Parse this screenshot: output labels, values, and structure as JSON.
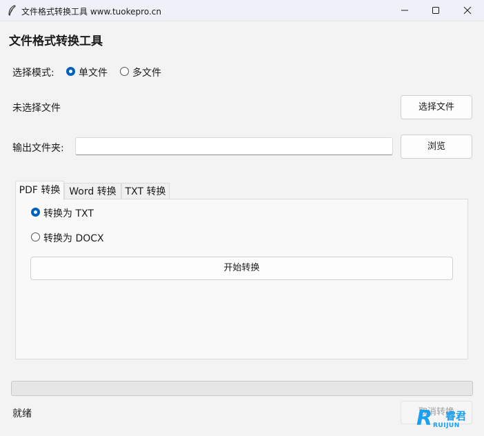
{
  "window": {
    "title": "文件格式转换工具 www.tuokepro.cn",
    "app_icon": "feather-icon",
    "controls": [
      "minimize-icon",
      "maximize-icon",
      "close-icon"
    ]
  },
  "header": {
    "title": "文件格式转换工具"
  },
  "mode": {
    "label": "选择模式:",
    "options": [
      {
        "label": "单文件",
        "selected": true
      },
      {
        "label": "多文件",
        "selected": false
      }
    ]
  },
  "file": {
    "status": "未选择文件",
    "select_button": "选择文件"
  },
  "output": {
    "label": "输出文件夹:",
    "value": "",
    "browse_button": "浏览"
  },
  "tabs": [
    {
      "label": "PDF 转换",
      "active": true
    },
    {
      "label": "Word 转换",
      "active": false
    },
    {
      "label": "TXT 转换",
      "active": false
    }
  ],
  "pdf_panel": {
    "options": [
      {
        "label": "转换为 TXT",
        "selected": true
      },
      {
        "label": "转换为 DOCX",
        "selected": false
      }
    ],
    "start_button": "开始转换"
  },
  "progress": {
    "value": 0
  },
  "status": {
    "text": "就绪",
    "cancel_button": "取消转换"
  },
  "watermark": {
    "letter": "R",
    "name_cn": "睿君",
    "name_en": "RUIJUN"
  },
  "colors": {
    "accent": "#0060c0",
    "watermark": "#1b9ff0"
  }
}
